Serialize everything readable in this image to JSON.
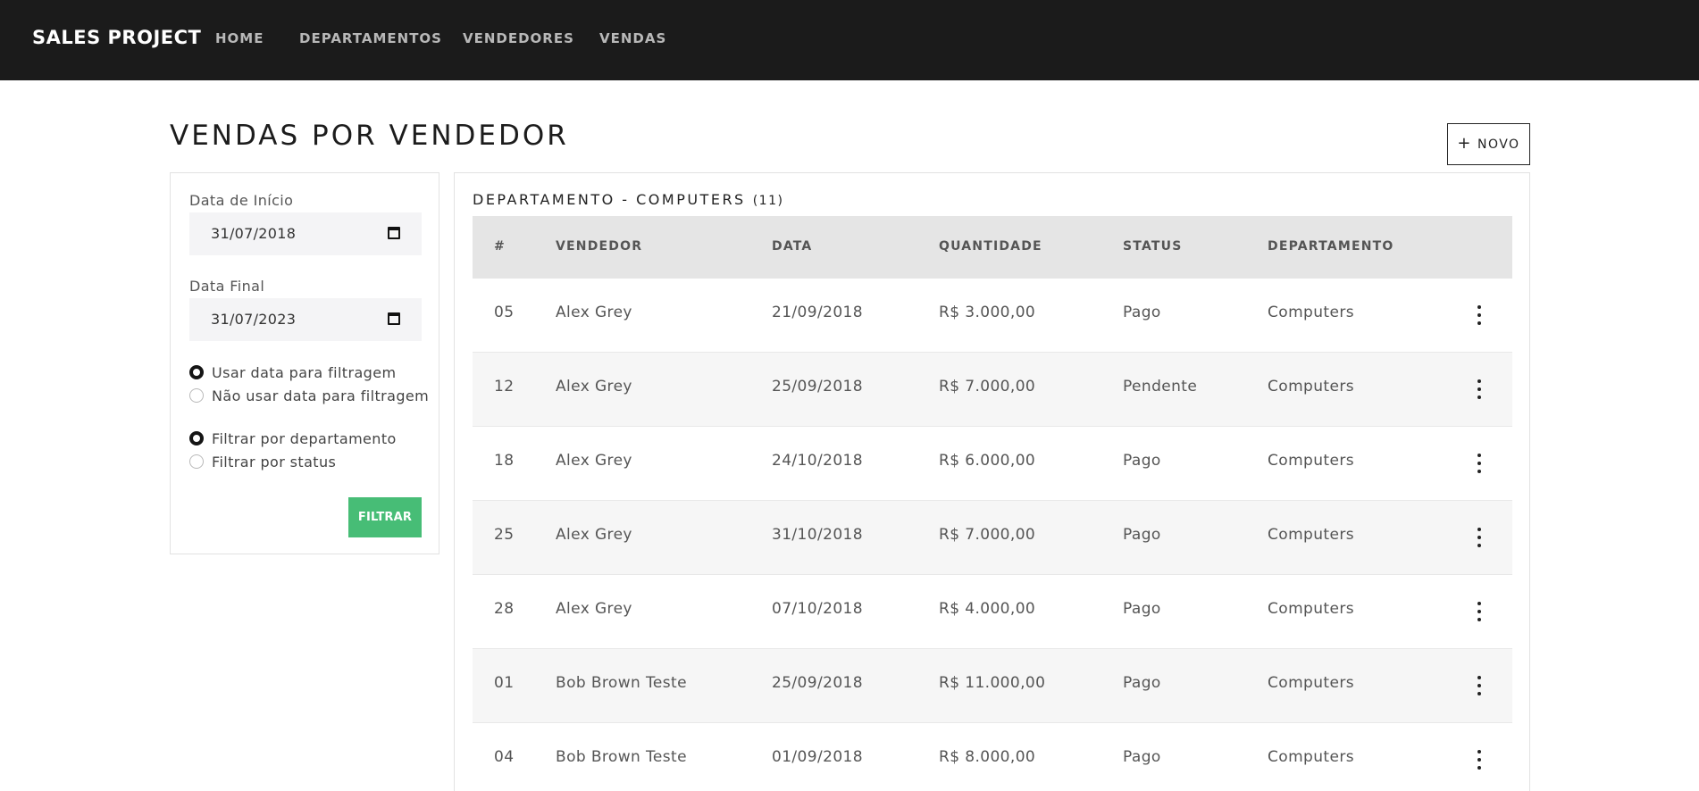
{
  "nav": {
    "brand": "SALES PROJECT",
    "links": [
      "HOME",
      "DEPARTAMENTOS",
      "VENDEDORES",
      "VENDAS"
    ]
  },
  "page": {
    "title": "VENDAS POR VENDEDOR",
    "new_button": {
      "icon": "plus-icon",
      "label": "NOVO"
    }
  },
  "filter": {
    "start_label": "Data de Início",
    "start_value": "31/07/2018",
    "end_label": "Data Final",
    "end_value": "31/07/2023",
    "date_options": [
      {
        "label": "Usar data para filtragem",
        "selected": true
      },
      {
        "label": "Não usar data para filtragem",
        "selected": false
      }
    ],
    "filter_options": [
      {
        "label": "Filtrar por departamento",
        "selected": true
      },
      {
        "label": "Filtrar por status",
        "selected": false
      }
    ],
    "submit_label": "FILTRAR",
    "submit_color": "#47bd76"
  },
  "table": {
    "title": "DEPARTAMENTO - COMPUTERS",
    "count": "(11)",
    "headers": [
      "#",
      "VENDEDOR",
      "DATA",
      "QUANTIDADE",
      "STATUS",
      "DEPARTAMENTO"
    ],
    "rows": [
      {
        "id": "05",
        "seller": "Alex Grey",
        "date": "21/09/2018",
        "amount": "R$ 3.000,00",
        "status": "Pago",
        "department": "Computers"
      },
      {
        "id": "12",
        "seller": "Alex Grey",
        "date": "25/09/2018",
        "amount": "R$ 7.000,00",
        "status": "Pendente",
        "department": "Computers"
      },
      {
        "id": "18",
        "seller": "Alex Grey",
        "date": "24/10/2018",
        "amount": "R$ 6.000,00",
        "status": "Pago",
        "department": "Computers"
      },
      {
        "id": "25",
        "seller": "Alex Grey",
        "date": "31/10/2018",
        "amount": "R$ 7.000,00",
        "status": "Pago",
        "department": "Computers"
      },
      {
        "id": "28",
        "seller": "Alex Grey",
        "date": "07/10/2018",
        "amount": "R$ 4.000,00",
        "status": "Pago",
        "department": "Computers"
      },
      {
        "id": "01",
        "seller": "Bob Brown Teste",
        "date": "25/09/2018",
        "amount": "R$ 11.000,00",
        "status": "Pago",
        "department": "Computers"
      },
      {
        "id": "04",
        "seller": "Bob Brown Teste",
        "date": "01/09/2018",
        "amount": "R$ 8.000,00",
        "status": "Pago",
        "department": "Computers"
      }
    ]
  }
}
